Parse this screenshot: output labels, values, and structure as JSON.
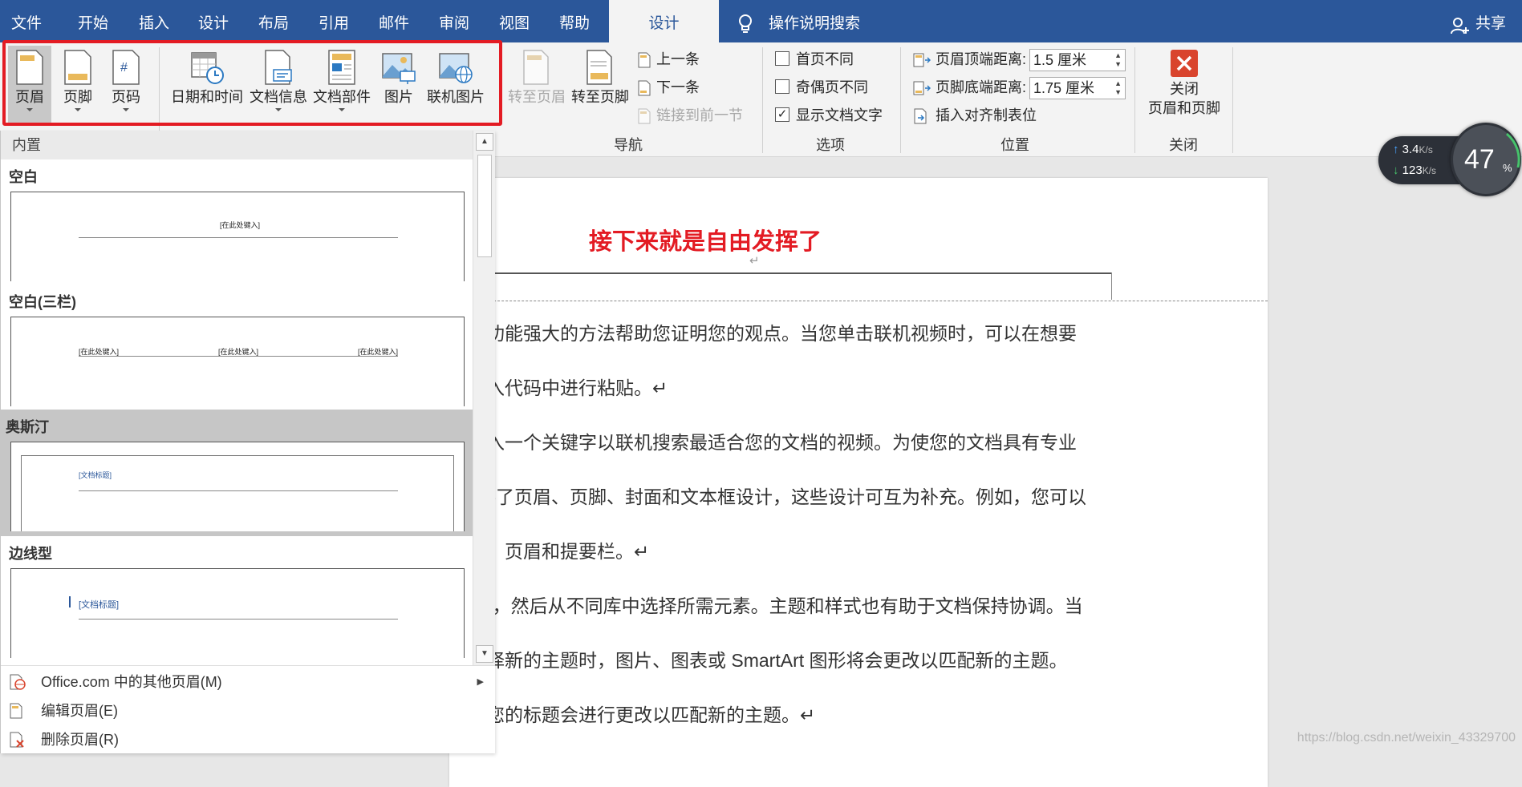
{
  "tabs": [
    "文件",
    "开始",
    "插入",
    "设计",
    "布局",
    "引用",
    "邮件",
    "审阅",
    "视图",
    "帮助"
  ],
  "active_tab": "设计",
  "tell_me": "操作说明搜索",
  "share": "共享",
  "ribbon": {
    "header_footer_group": {
      "header": "页眉",
      "footer": "页脚",
      "page_number": "页码"
    },
    "insert_group": {
      "date_time": "日期和时间",
      "doc_info": "文档信息",
      "quick_parts": "文档部件",
      "pictures": "图片",
      "online_pictures": "联机图片"
    },
    "navigation": {
      "go_to_header": "转至页眉",
      "go_to_footer": "转至页脚",
      "previous": "上一条",
      "next": "下一条",
      "link_to_previous": "链接到前一节",
      "label": "导航"
    },
    "options": {
      "different_first_page": "首页不同",
      "different_odd_even": "奇偶页不同",
      "show_document_text": "显示文档文字",
      "show_document_text_checked": true,
      "label": "选项"
    },
    "position": {
      "header_from_top_label": "页眉顶端距离:",
      "header_from_top_value": "1.5 厘米",
      "footer_from_bottom_label": "页脚底端距离:",
      "footer_from_bottom_value": "1.75 厘米",
      "insert_alignment_tab": "插入对齐制表位",
      "label": "位置"
    },
    "close": {
      "line1": "关闭",
      "line2": "页眉和页脚",
      "label": "关闭"
    }
  },
  "gallery": {
    "section": "内置",
    "items": [
      {
        "name": "空白",
        "placeholder": "[在此处键入]"
      },
      {
        "name": "空白(三栏)",
        "placeholder": "[在此处键入]"
      },
      {
        "name": "奥斯汀",
        "placeholder": "[文档标题]"
      },
      {
        "name": "边线型",
        "placeholder": "[文档标题]"
      }
    ],
    "footer": {
      "more": "Office.com 中的其他页眉(M)",
      "edit": "编辑页眉(E)",
      "remove": "删除页眉(R)"
    }
  },
  "document": {
    "header_text": "接下来就是自由发挥了",
    "body_lines": [
      "供了功能强大的方法帮助您证明您的观点。当您单击联机视频时，可以在想要",
      "的嵌入代码中进行粘贴。↵",
      "以键入一个关键字以联机搜索最适合您的文档的视频。为使您的文档具有专业",
      "提供了页眉、页脚、封面和文本框设计，这些设计可互为补充。例如，您可以",
      "封面、页眉和提要栏。↵",
      "插入”，然后从不同库中选择所需元素。主题和样式也有助于文档保持协调。当",
      "并选择新的主题时，图片、图表或 SmartArt 图形将会更改以匹配新的主题。",
      "时，您的标题会进行更改以匹配新的主题。↵"
    ],
    "watermark": "https://blog.csdn.net/weixin_43329700"
  },
  "speed_widget": {
    "upload": "3.4",
    "download": "123",
    "unit": "K/s",
    "percent": "47",
    "percent_sign": "%"
  },
  "colors": {
    "title_bar": "#2b579a",
    "accent_red": "#e31b23"
  }
}
